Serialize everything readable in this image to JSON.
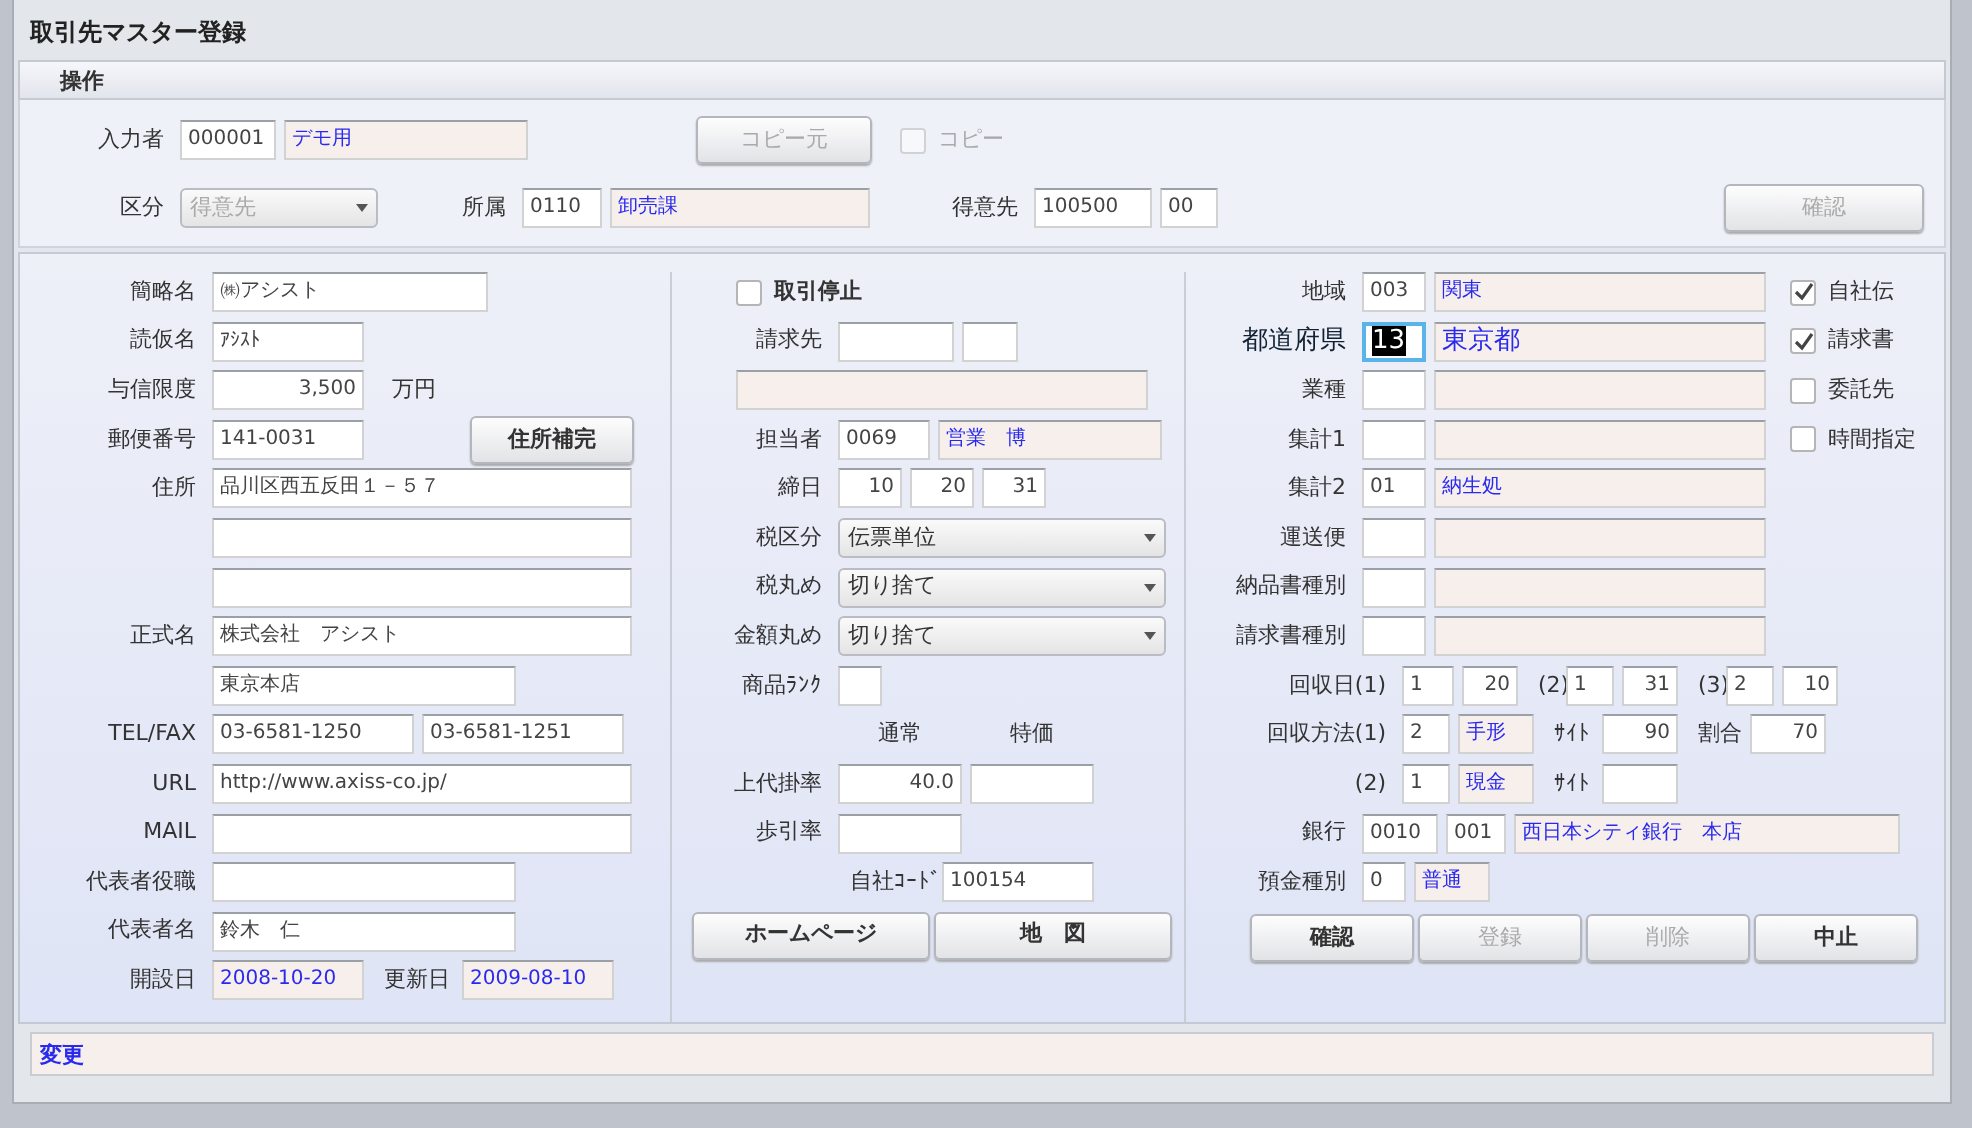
{
  "window": {
    "title": "取引先マスター登録"
  },
  "menu": [
    {
      "label": "操作"
    }
  ],
  "header": {
    "operator": {
      "label": "入力者",
      "code": "000001",
      "name": "デモ用"
    },
    "copy_source_button": {
      "label": "コピー元",
      "disabled": true
    },
    "copy_checkbox": {
      "label": "コピー",
      "checked": false,
      "disabled": true
    },
    "category": {
      "label": "区分",
      "value": "得意先",
      "disabled": true
    },
    "department": {
      "label": "所属",
      "code": "0110",
      "name": "卸売課"
    },
    "customer": {
      "label": "得意先",
      "code": "100500",
      "branch": "00"
    },
    "confirm_button": {
      "label": "確認",
      "disabled": true
    }
  },
  "left": [
    {
      "label": "簡略名",
      "items": [
        {
          "kind": "input",
          "value": "㈱アシスト"
        }
      ]
    },
    {
      "label": "読仮名",
      "items": [
        {
          "kind": "input",
          "value": "ｱｼｽﾄ"
        }
      ]
    },
    {
      "label": "与信限度",
      "items": [
        {
          "kind": "number",
          "value": "3,500"
        },
        {
          "kind": "unit",
          "text": "万円"
        }
      ]
    },
    {
      "label": "郵便番号",
      "items": [
        {
          "kind": "input",
          "value": "141-0031"
        },
        {
          "kind": "button",
          "label": "住所補完",
          "disabled": false
        }
      ]
    },
    {
      "label": "住所",
      "items": [
        {
          "kind": "input",
          "value": "品川区西五反田１－５７"
        }
      ]
    },
    {
      "items": [
        {
          "kind": "input"
        }
      ]
    },
    {
      "items": [
        {
          "kind": "input"
        }
      ]
    },
    {
      "label": "正式名",
      "items": [
        {
          "kind": "input",
          "value": "株式会社　アシスト"
        }
      ]
    },
    {
      "items": [
        {
          "kind": "input",
          "value": "東京本店"
        }
      ]
    },
    {
      "label": "TEL/FAX",
      "items": [
        {
          "kind": "input",
          "value": "03-6581-1250"
        },
        {
          "kind": "input",
          "value": "03-6581-1251"
        }
      ]
    },
    {
      "label": "URL",
      "items": [
        {
          "kind": "input",
          "value": "http://www.axiss-co.jp/"
        }
      ]
    },
    {
      "label": "MAIL",
      "items": [
        {
          "kind": "input"
        }
      ]
    },
    {
      "label": "代表者役職",
      "items": [
        {
          "kind": "input"
        }
      ]
    },
    {
      "label": "代表者名",
      "items": [
        {
          "kind": "input",
          "value": "鈴木　仁"
        }
      ]
    },
    {
      "label": "開設日",
      "items": [
        {
          "kind": "display",
          "value": "2008-10-20"
        },
        {
          "kind": "label",
          "text": "更新日"
        },
        {
          "kind": "display",
          "value": "2009-08-10"
        }
      ]
    }
  ],
  "middle": [
    {
      "items": [
        {
          "kind": "checkbox",
          "label": "取引停止",
          "checked": false
        }
      ]
    },
    {
      "label": "請求先",
      "items": [
        {
          "kind": "input"
        },
        {
          "kind": "input"
        }
      ]
    },
    {
      "items": [
        {
          "kind": "display"
        }
      ]
    },
    {
      "label": "担当者",
      "items": [
        {
          "kind": "input",
          "value": "0069"
        },
        {
          "kind": "display",
          "value": "営業　博"
        }
      ]
    },
    {
      "label": "締日",
      "items": [
        {
          "kind": "number",
          "value": "10"
        },
        {
          "kind": "number",
          "value": "20"
        },
        {
          "kind": "number",
          "value": "31"
        }
      ]
    },
    {
      "label": "税区分",
      "items": [
        {
          "kind": "select",
          "value": "伝票単位"
        }
      ]
    },
    {
      "label": "税丸め",
      "items": [
        {
          "kind": "select",
          "value": "切り捨て"
        }
      ]
    },
    {
      "label": "金額丸め",
      "items": [
        {
          "kind": "select",
          "value": "切り捨て"
        }
      ]
    },
    {
      "label": "商品ﾗﾝｸ",
      "items": [
        {
          "kind": "input"
        }
      ]
    },
    {
      "items": [
        {
          "kind": "caption",
          "text": "通常"
        },
        {
          "kind": "caption",
          "text": "特価"
        }
      ]
    },
    {
      "label": "上代掛率",
      "items": [
        {
          "kind": "number",
          "value": "40.0"
        },
        {
          "kind": "input"
        }
      ]
    },
    {
      "label": "歩引率",
      "items": [
        {
          "kind": "input"
        }
      ]
    },
    {
      "items": [
        {
          "kind": "label",
          "text": "自社ｺｰﾄﾞ"
        },
        {
          "kind": "input",
          "value": "100154"
        }
      ]
    }
  ],
  "middle_buttons": [
    {
      "label": "ホームページ",
      "disabled": false
    },
    {
      "label": "地　図",
      "disabled": false
    }
  ],
  "right": [
    {
      "label": "地域",
      "items": [
        {
          "kind": "input",
          "value": "003"
        },
        {
          "kind": "display",
          "value": "関東"
        }
      ]
    },
    {
      "label": "都道府県",
      "focused": true,
      "items": [
        {
          "kind": "input",
          "value": "13",
          "selected": true
        },
        {
          "kind": "display",
          "value": "東京都"
        }
      ]
    },
    {
      "label": "業種",
      "focused": false,
      "items": [
        {
          "kind": "input"
        },
        {
          "kind": "display"
        }
      ]
    },
    {
      "label": "集計1",
      "items": [
        {
          "kind": "input"
        },
        {
          "kind": "display"
        }
      ]
    },
    {
      "label": "集計2",
      "items": [
        {
          "kind": "input",
          "value": "01"
        },
        {
          "kind": "display",
          "value": "納生処"
        }
      ]
    },
    {
      "label": "運送便",
      "items": [
        {
          "kind": "input"
        },
        {
          "kind": "display"
        }
      ]
    },
    {
      "label": "納品書種別",
      "items": [
        {
          "kind": "input"
        },
        {
          "kind": "display"
        }
      ]
    },
    {
      "label": "請求書種別",
      "items": [
        {
          "kind": "input"
        },
        {
          "kind": "display"
        }
      ]
    }
  ],
  "options": [
    {
      "label": "自社伝",
      "checked": true
    },
    {
      "label": "請求書",
      "checked": true
    },
    {
      "label": "委託先",
      "checked": false
    },
    {
      "label": "時間指定",
      "checked": false
    }
  ],
  "payment": [
    {
      "label": "回収日(1)",
      "items": [
        {
          "kind": "input",
          "value": "1"
        },
        {
          "kind": "number",
          "value": "20"
        },
        {
          "kind": "label",
          "text": "(2)"
        },
        {
          "kind": "input",
          "value": "1"
        },
        {
          "kind": "number",
          "value": "31"
        },
        {
          "kind": "label",
          "text": "(3)"
        },
        {
          "kind": "input",
          "value": "2"
        },
        {
          "kind": "number",
          "value": "10"
        }
      ]
    },
    {
      "label": "回収方法(1)",
      "items": [
        {
          "kind": "input",
          "value": "2"
        },
        {
          "kind": "display",
          "value": "手形"
        },
        {
          "kind": "label",
          "text": "ｻｲﾄ"
        },
        {
          "kind": "number",
          "value": "90"
        },
        {
          "kind": "label",
          "text": "割合"
        },
        {
          "kind": "number",
          "value": "70"
        }
      ]
    },
    {
      "label": "(2)",
      "items": [
        {
          "kind": "input",
          "value": "1"
        },
        {
          "kind": "display",
          "value": "現金"
        },
        {
          "kind": "label",
          "text": "ｻｲﾄ"
        },
        {
          "kind": "input"
        }
      ]
    },
    {
      "label": "銀行",
      "items": [
        {
          "kind": "input",
          "value": "0010"
        },
        {
          "kind": "input",
          "value": "001"
        },
        {
          "kind": "display",
          "value": "西日本シティ銀行　本店"
        }
      ]
    },
    {
      "label": "預金種別",
      "items": [
        {
          "kind": "input",
          "value": "0"
        },
        {
          "kind": "display",
          "value": "普通"
        }
      ]
    }
  ],
  "right_buttons": [
    {
      "label": "確認",
      "disabled": false
    },
    {
      "label": "登録",
      "disabled": true
    },
    {
      "label": "削除",
      "disabled": true
    },
    {
      "label": "中止",
      "disabled": false
    }
  ],
  "status_bar": {
    "text": "変更"
  }
}
